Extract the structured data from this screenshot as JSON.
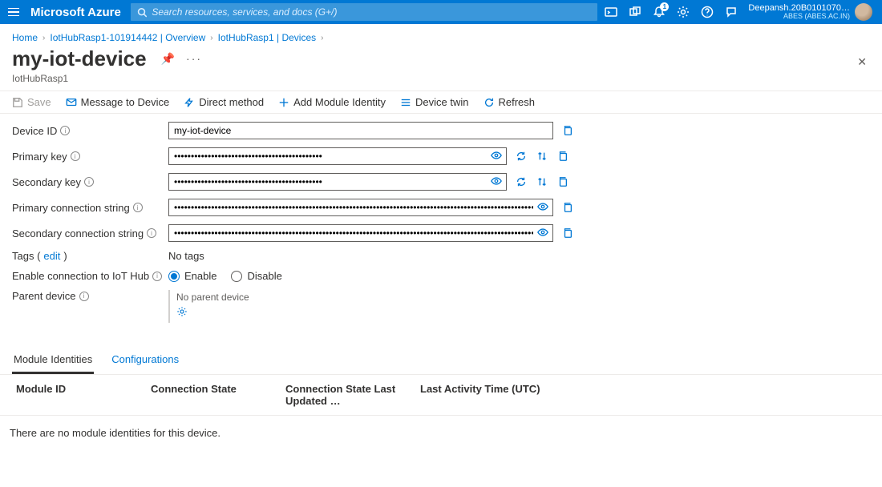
{
  "header": {
    "brand": "Microsoft Azure",
    "search_placeholder": "Search resources, services, and docs (G+/)",
    "notif_count": "1",
    "user_name": "Deepansh.20B0101070…",
    "user_org": "ABES (ABES.AC.IN)"
  },
  "crumbs": {
    "home": "Home",
    "c1": "IotHubRasp1-101914442 | Overview",
    "c2": "IotHubRasp1 | Devices"
  },
  "page": {
    "title": "my-iot-device",
    "subtitle": "IotHubRasp1"
  },
  "toolbar": {
    "save": "Save",
    "message": "Message to Device",
    "direct": "Direct method",
    "addModule": "Add Module Identity",
    "twin": "Device twin",
    "refresh": "Refresh"
  },
  "form": {
    "device_id_label": "Device ID",
    "device_id": "my-iot-device",
    "pk_label": "Primary key",
    "pk": "••••••••••••••••••••••••••••••••••••••••••••",
    "sk_label": "Secondary key",
    "sk": "••••••••••••••••••••••••••••••••••••••••••••",
    "pcs_label": "Primary connection string",
    "pcs": "••••••••••••••••••••••••••••••••••••••••••••••••••••••••••••••••••••••••••••••••••••••••••••••••••••••••••••",
    "scs_label": "Secondary connection string",
    "scs": "••••••••••••••••••••••••••••••••••••••••••••••••••••••••••••••••••••••••••••••••••••••••••••••••••••••••••••",
    "tags_label": "Tags (",
    "tags_edit": "edit",
    "tags_close": ")",
    "tags_value": "No tags",
    "enable_label": "Enable connection to IoT Hub",
    "enable_opt": "Enable",
    "disable_opt": "Disable",
    "parent_label": "Parent device",
    "parent_value": "No parent device"
  },
  "tabs": {
    "mod": "Module Identities",
    "conf": "Configurations"
  },
  "table": {
    "h1": "Module ID",
    "h2": "Connection State",
    "h3": "Connection State Last Updated …",
    "h4": "Last Activity Time (UTC)",
    "empty": "There are no module identities for this device."
  }
}
